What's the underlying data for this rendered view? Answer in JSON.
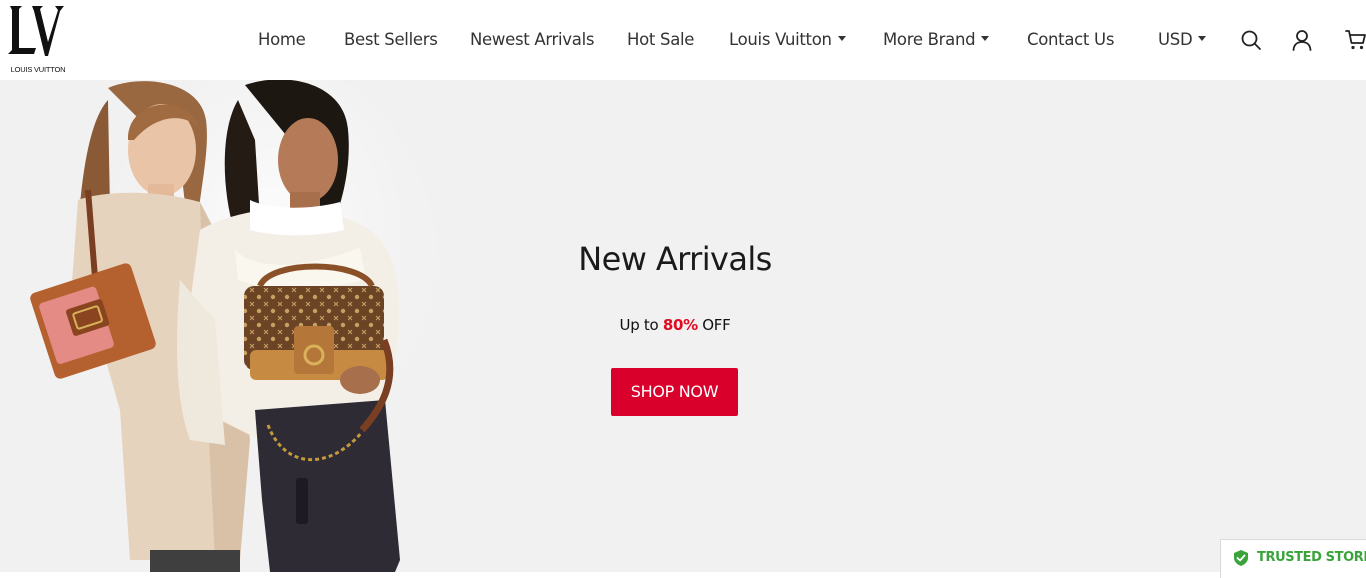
{
  "brand": {
    "logo_caption": "LOUIS VUITTON"
  },
  "nav": {
    "items": [
      {
        "label": "Home"
      },
      {
        "label": "Best Sellers"
      },
      {
        "label": "Newest Arrivals"
      },
      {
        "label": "Hot Sale"
      },
      {
        "label": "Louis Vuitton"
      },
      {
        "label": "More Brand"
      },
      {
        "label": "Contact Us"
      }
    ],
    "currency": "USD",
    "icons": [
      "search-icon",
      "user-icon",
      "cart-icon"
    ]
  },
  "hero": {
    "title": "New Arrivals",
    "sub_prefix": "Up to ",
    "sub_percent": "80%",
    "sub_suffix": " OFF",
    "cta": "SHOP NOW",
    "cta_color": "#d9002c",
    "percent_color": "#e20a22"
  },
  "badge": {
    "label": "TRUSTED STORE",
    "icon": "shield-check-icon",
    "color": "#3aa43b"
  }
}
